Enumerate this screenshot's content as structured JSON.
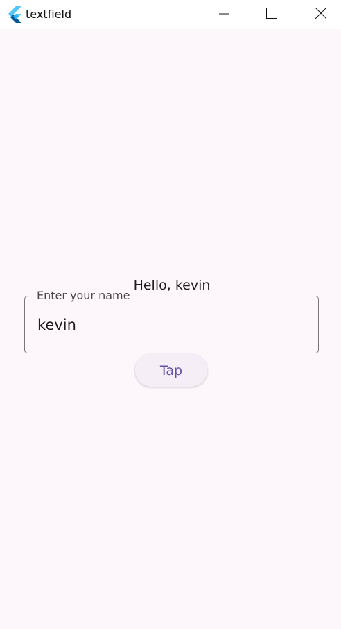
{
  "window": {
    "title": "textfield",
    "controls": [
      "minimize-icon",
      "maximize-icon",
      "close-icon"
    ]
  },
  "main": {
    "greeting": "Hello, kevin",
    "name_field": {
      "label": "Enter your name",
      "value": "kevin"
    },
    "tap_button_label": "Tap"
  },
  "colors": {
    "background": "#fdf7fc",
    "button_text": "#6650a4",
    "button_bg": "#f5eef6",
    "field_border": "#7b757e"
  }
}
